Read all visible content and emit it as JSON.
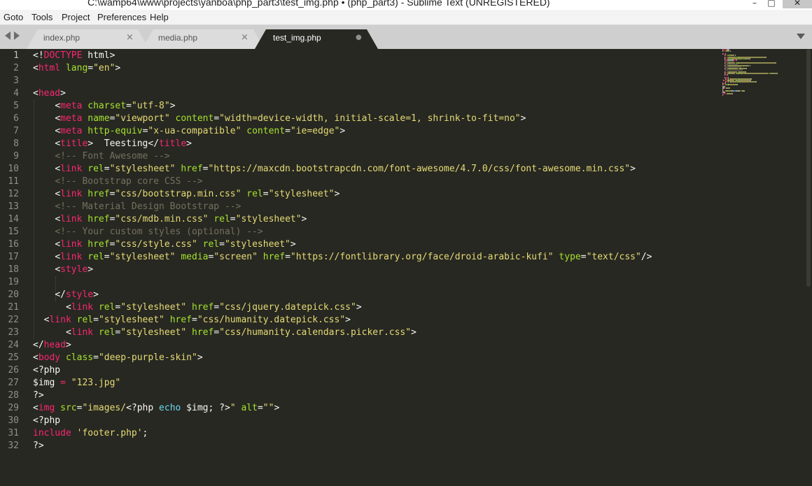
{
  "window": {
    "title": "C:\\wamp64\\www\\projects\\yanboa\\php_part3\\test_img.php • (php_part3) - Sublime Text (UNREGISTERED)",
    "controls": {
      "minimize": "–",
      "maximize": "□",
      "close": "✕"
    }
  },
  "menu": [
    "Goto",
    "Tools",
    "Project",
    "Preferences",
    "Help"
  ],
  "tabs": [
    {
      "label": "index.php",
      "close": "×",
      "active": false
    },
    {
      "label": "media.php",
      "close": "×",
      "active": false
    },
    {
      "label": "test_img.php",
      "close": "●",
      "active": true
    }
  ],
  "icons": {
    "nav_left": "chevron-left-icon",
    "nav_right": "chevron-right-icon",
    "tab_dropdown": "chevron-down-icon"
  },
  "colors": {
    "background": "#272822",
    "tag": "#f92672",
    "attribute": "#a6e22e",
    "string": "#e6db74",
    "comment": "#75715e",
    "keyword": "#66d9ef",
    "text": "#f8f8f2",
    "line_number": "#8f908a"
  },
  "editor": {
    "current_line": 1,
    "lines": [
      {
        "n": "1",
        "indent": "",
        "tokens": [
          {
            "t": "<!",
            "c": "pun"
          },
          {
            "t": "DOCTYPE",
            "c": "tag"
          },
          {
            "t": " html>",
            "c": "pun"
          }
        ]
      },
      {
        "n": "2",
        "indent": "",
        "tokens": [
          {
            "t": "<",
            "c": "pun"
          },
          {
            "t": "html",
            "c": "tag"
          },
          {
            "t": " ",
            "c": "pun"
          },
          {
            "t": "lang",
            "c": "attr"
          },
          {
            "t": "=",
            "c": "pun"
          },
          {
            "t": "\"en\"",
            "c": "str"
          },
          {
            "t": ">",
            "c": "pun"
          }
        ]
      },
      {
        "n": "3",
        "indent": "",
        "tokens": []
      },
      {
        "n": "4",
        "indent": "",
        "tokens": [
          {
            "t": "<",
            "c": "pun"
          },
          {
            "t": "head",
            "c": "tag"
          },
          {
            "t": ">",
            "c": "pun"
          }
        ]
      },
      {
        "n": "5",
        "indent": "    ",
        "tokens": [
          {
            "t": "<",
            "c": "pun"
          },
          {
            "t": "meta",
            "c": "tag"
          },
          {
            "t": " ",
            "c": "pun"
          },
          {
            "t": "charset",
            "c": "attr"
          },
          {
            "t": "=",
            "c": "pun"
          },
          {
            "t": "\"utf-8\"",
            "c": "str"
          },
          {
            "t": ">",
            "c": "pun"
          }
        ]
      },
      {
        "n": "6",
        "indent": "    ",
        "tokens": [
          {
            "t": "<",
            "c": "pun"
          },
          {
            "t": "meta",
            "c": "tag"
          },
          {
            "t": " ",
            "c": "pun"
          },
          {
            "t": "name",
            "c": "attr"
          },
          {
            "t": "=",
            "c": "pun"
          },
          {
            "t": "\"viewport\"",
            "c": "str"
          },
          {
            "t": " ",
            "c": "pun"
          },
          {
            "t": "content",
            "c": "attr"
          },
          {
            "t": "=",
            "c": "pun"
          },
          {
            "t": "\"width=device-width, initial-scale=1, shrink-to-fit=no\"",
            "c": "str"
          },
          {
            "t": ">",
            "c": "pun"
          }
        ]
      },
      {
        "n": "7",
        "indent": "    ",
        "tokens": [
          {
            "t": "<",
            "c": "pun"
          },
          {
            "t": "meta",
            "c": "tag"
          },
          {
            "t": " ",
            "c": "pun"
          },
          {
            "t": "http-equiv",
            "c": "attr"
          },
          {
            "t": "=",
            "c": "pun"
          },
          {
            "t": "\"x-ua-compatible\"",
            "c": "str"
          },
          {
            "t": " ",
            "c": "pun"
          },
          {
            "t": "content",
            "c": "attr"
          },
          {
            "t": "=",
            "c": "pun"
          },
          {
            "t": "\"ie=edge\"",
            "c": "str"
          },
          {
            "t": ">",
            "c": "pun"
          }
        ]
      },
      {
        "n": "8",
        "indent": "    ",
        "tokens": [
          {
            "t": "<",
            "c": "pun"
          },
          {
            "t": "title",
            "c": "tag"
          },
          {
            "t": ">  Teesting</",
            "c": "pun"
          },
          {
            "t": "title",
            "c": "tag"
          },
          {
            "t": ">",
            "c": "pun"
          }
        ]
      },
      {
        "n": "9",
        "indent": "    ",
        "tokens": [
          {
            "t": "<!-- Font Awesome -->",
            "c": "cmt"
          }
        ]
      },
      {
        "n": "10",
        "indent": "    ",
        "tokens": [
          {
            "t": "<",
            "c": "pun"
          },
          {
            "t": "link",
            "c": "tag"
          },
          {
            "t": " ",
            "c": "pun"
          },
          {
            "t": "rel",
            "c": "attr"
          },
          {
            "t": "=",
            "c": "pun"
          },
          {
            "t": "\"stylesheet\"",
            "c": "str"
          },
          {
            "t": " ",
            "c": "pun"
          },
          {
            "t": "href",
            "c": "attr"
          },
          {
            "t": "=",
            "c": "pun"
          },
          {
            "t": "\"https://maxcdn.bootstrapcdn.com/font-awesome/4.7.0/css/font-awesome.min.css\"",
            "c": "str"
          },
          {
            "t": ">",
            "c": "pun"
          }
        ]
      },
      {
        "n": "11",
        "indent": "    ",
        "tokens": [
          {
            "t": "<!-- Bootstrap core CSS -->",
            "c": "cmt"
          }
        ]
      },
      {
        "n": "12",
        "indent": "    ",
        "tokens": [
          {
            "t": "<",
            "c": "pun"
          },
          {
            "t": "link",
            "c": "tag"
          },
          {
            "t": " ",
            "c": "pun"
          },
          {
            "t": "href",
            "c": "attr"
          },
          {
            "t": "=",
            "c": "pun"
          },
          {
            "t": "\"css/bootstrap.min.css\"",
            "c": "str"
          },
          {
            "t": " ",
            "c": "pun"
          },
          {
            "t": "rel",
            "c": "attr"
          },
          {
            "t": "=",
            "c": "pun"
          },
          {
            "t": "\"stylesheet\"",
            "c": "str"
          },
          {
            "t": ">",
            "c": "pun"
          }
        ]
      },
      {
        "n": "13",
        "indent": "    ",
        "tokens": [
          {
            "t": "<!-- Material Design Bootstrap -->",
            "c": "cmt"
          }
        ]
      },
      {
        "n": "14",
        "indent": "    ",
        "tokens": [
          {
            "t": "<",
            "c": "pun"
          },
          {
            "t": "link",
            "c": "tag"
          },
          {
            "t": " ",
            "c": "pun"
          },
          {
            "t": "href",
            "c": "attr"
          },
          {
            "t": "=",
            "c": "pun"
          },
          {
            "t": "\"css/mdb.min.css\"",
            "c": "str"
          },
          {
            "t": " ",
            "c": "pun"
          },
          {
            "t": "rel",
            "c": "attr"
          },
          {
            "t": "=",
            "c": "pun"
          },
          {
            "t": "\"stylesheet\"",
            "c": "str"
          },
          {
            "t": ">",
            "c": "pun"
          }
        ]
      },
      {
        "n": "15",
        "indent": "    ",
        "tokens": [
          {
            "t": "<!-- Your custom styles (optional) -->",
            "c": "cmt"
          }
        ]
      },
      {
        "n": "16",
        "indent": "    ",
        "tokens": [
          {
            "t": "<",
            "c": "pun"
          },
          {
            "t": "link",
            "c": "tag"
          },
          {
            "t": " ",
            "c": "pun"
          },
          {
            "t": "href",
            "c": "attr"
          },
          {
            "t": "=",
            "c": "pun"
          },
          {
            "t": "\"css/style.css\"",
            "c": "str"
          },
          {
            "t": " ",
            "c": "pun"
          },
          {
            "t": "rel",
            "c": "attr"
          },
          {
            "t": "=",
            "c": "pun"
          },
          {
            "t": "\"stylesheet\"",
            "c": "str"
          },
          {
            "t": ">",
            "c": "pun"
          }
        ]
      },
      {
        "n": "17",
        "indent": "    ",
        "tokens": [
          {
            "t": "<",
            "c": "pun"
          },
          {
            "t": "link",
            "c": "tag"
          },
          {
            "t": " ",
            "c": "pun"
          },
          {
            "t": "rel",
            "c": "attr"
          },
          {
            "t": "=",
            "c": "pun"
          },
          {
            "t": "\"stylesheet\"",
            "c": "str"
          },
          {
            "t": " ",
            "c": "pun"
          },
          {
            "t": "media",
            "c": "attr"
          },
          {
            "t": "=",
            "c": "pun"
          },
          {
            "t": "\"screen\"",
            "c": "str"
          },
          {
            "t": " ",
            "c": "pun"
          },
          {
            "t": "href",
            "c": "attr"
          },
          {
            "t": "=",
            "c": "pun"
          },
          {
            "t": "\"https://fontlibrary.org/face/droid-arabic-kufi\"",
            "c": "str"
          },
          {
            "t": " ",
            "c": "pun"
          },
          {
            "t": "type",
            "c": "attr"
          },
          {
            "t": "=",
            "c": "pun"
          },
          {
            "t": "\"text/css\"",
            "c": "str"
          },
          {
            "t": "/>",
            "c": "pun"
          }
        ]
      },
      {
        "n": "18",
        "indent": "    ",
        "tokens": [
          {
            "t": "<",
            "c": "pun"
          },
          {
            "t": "style",
            "c": "tag"
          },
          {
            "t": ">",
            "c": "pun"
          }
        ]
      },
      {
        "n": "19",
        "indent": "",
        "tokens": []
      },
      {
        "n": "20",
        "indent": "    ",
        "tokens": [
          {
            "t": "</",
            "c": "pun"
          },
          {
            "t": "style",
            "c": "tag"
          },
          {
            "t": ">",
            "c": "pun"
          }
        ]
      },
      {
        "n": "21",
        "indent": "      ",
        "tokens": [
          {
            "t": "<",
            "c": "pun"
          },
          {
            "t": "link",
            "c": "tag"
          },
          {
            "t": " ",
            "c": "pun"
          },
          {
            "t": "rel",
            "c": "attr"
          },
          {
            "t": "=",
            "c": "pun"
          },
          {
            "t": "\"stylesheet\"",
            "c": "str"
          },
          {
            "t": " ",
            "c": "pun"
          },
          {
            "t": "href",
            "c": "attr"
          },
          {
            "t": "=",
            "c": "pun"
          },
          {
            "t": "\"css/jquery.datepick.css\"",
            "c": "str"
          },
          {
            "t": ">",
            "c": "pun"
          }
        ]
      },
      {
        "n": "22",
        "indent": "  ",
        "tokens": [
          {
            "t": "<",
            "c": "pun"
          },
          {
            "t": "link",
            "c": "tag"
          },
          {
            "t": " ",
            "c": "pun"
          },
          {
            "t": "rel",
            "c": "attr"
          },
          {
            "t": "=",
            "c": "pun"
          },
          {
            "t": "\"stylesheet\"",
            "c": "str"
          },
          {
            "t": " ",
            "c": "pun"
          },
          {
            "t": "href",
            "c": "attr"
          },
          {
            "t": "=",
            "c": "pun"
          },
          {
            "t": "\"css/humanity.datepick.css\"",
            "c": "str"
          },
          {
            "t": ">",
            "c": "pun"
          }
        ]
      },
      {
        "n": "23",
        "indent": "      ",
        "tokens": [
          {
            "t": "<",
            "c": "pun"
          },
          {
            "t": "link",
            "c": "tag"
          },
          {
            "t": " ",
            "c": "pun"
          },
          {
            "t": "rel",
            "c": "attr"
          },
          {
            "t": "=",
            "c": "pun"
          },
          {
            "t": "\"stylesheet\"",
            "c": "str"
          },
          {
            "t": " ",
            "c": "pun"
          },
          {
            "t": "href",
            "c": "attr"
          },
          {
            "t": "=",
            "c": "pun"
          },
          {
            "t": "\"css/humanity.calendars.picker.css\"",
            "c": "str"
          },
          {
            "t": ">",
            "c": "pun"
          }
        ]
      },
      {
        "n": "24",
        "indent": "",
        "tokens": [
          {
            "t": "</",
            "c": "pun"
          },
          {
            "t": "head",
            "c": "tag"
          },
          {
            "t": ">",
            "c": "pun"
          }
        ]
      },
      {
        "n": "25",
        "indent": "",
        "tokens": [
          {
            "t": "<",
            "c": "pun"
          },
          {
            "t": "body",
            "c": "tag"
          },
          {
            "t": " ",
            "c": "pun"
          },
          {
            "t": "class",
            "c": "attr"
          },
          {
            "t": "=",
            "c": "pun"
          },
          {
            "t": "\"deep-purple-skin\"",
            "c": "str"
          },
          {
            "t": ">",
            "c": "pun"
          }
        ]
      },
      {
        "n": "26",
        "indent": "",
        "tokens": [
          {
            "t": "<?php",
            "c": "pun"
          }
        ]
      },
      {
        "n": "27",
        "indent": "",
        "tokens": [
          {
            "t": "$img",
            "c": "pun"
          },
          {
            "t": " ",
            "c": "pun"
          },
          {
            "t": "=",
            "c": "tag"
          },
          {
            "t": " ",
            "c": "pun"
          },
          {
            "t": "\"123.jpg\"",
            "c": "str"
          }
        ]
      },
      {
        "n": "28",
        "indent": "",
        "tokens": [
          {
            "t": "?>",
            "c": "pun"
          }
        ]
      },
      {
        "n": "29",
        "indent": "",
        "tokens": [
          {
            "t": "<",
            "c": "pun"
          },
          {
            "t": "img",
            "c": "tag"
          },
          {
            "t": " ",
            "c": "pun"
          },
          {
            "t": "src",
            "c": "attr"
          },
          {
            "t": "=",
            "c": "pun"
          },
          {
            "t": "\"images/",
            "c": "str"
          },
          {
            "t": "<?php ",
            "c": "pun"
          },
          {
            "t": "echo",
            "c": "kw"
          },
          {
            "t": " $img; ?>",
            "c": "pun"
          },
          {
            "t": "\"",
            "c": "str"
          },
          {
            "t": " ",
            "c": "pun"
          },
          {
            "t": "alt",
            "c": "attr"
          },
          {
            "t": "=",
            "c": "pun"
          },
          {
            "t": "\"\"",
            "c": "str"
          },
          {
            "t": ">",
            "c": "pun"
          }
        ]
      },
      {
        "n": "30",
        "indent": "",
        "tokens": [
          {
            "t": "<?php",
            "c": "pun"
          }
        ]
      },
      {
        "n": "31",
        "indent": "",
        "tokens": [
          {
            "t": "include",
            "c": "tag"
          },
          {
            "t": " ",
            "c": "pun"
          },
          {
            "t": "'footer.php'",
            "c": "str"
          },
          {
            "t": ";",
            "c": "pun"
          }
        ]
      },
      {
        "n": "32",
        "indent": "",
        "tokens": [
          {
            "t": "?>",
            "c": "pun"
          }
        ]
      }
    ]
  }
}
